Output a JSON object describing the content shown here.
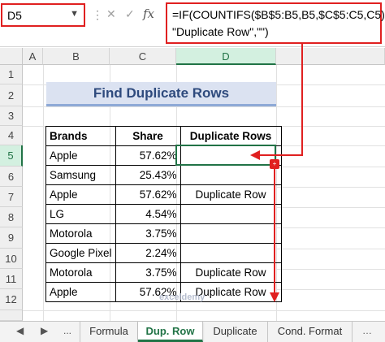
{
  "name_box": {
    "value": "D5"
  },
  "formula_bar": {
    "formula_line1": "=IF(COUNTIFS($B$5:B5,B5,$C$5:C5,C5)>1,",
    "formula_line2": "\"Duplicate Row\",\"\")",
    "fx_label": "fx"
  },
  "columns": [
    "A",
    "B",
    "C",
    "D"
  ],
  "rows": [
    "1",
    "2",
    "3",
    "4",
    "5",
    "6",
    "7",
    "8",
    "9",
    "10",
    "11",
    "12"
  ],
  "title": "Find Duplicate Rows",
  "table": {
    "headers": [
      "Brands",
      "Share",
      "Duplicate Rows"
    ],
    "rows": [
      [
        "Apple",
        "57.62%",
        ""
      ],
      [
        "Samsung",
        "25.43%",
        ""
      ],
      [
        "Apple",
        "57.62%",
        "Duplicate Row"
      ],
      [
        "LG",
        "4.54%",
        ""
      ],
      [
        "Motorola",
        "3.75%",
        ""
      ],
      [
        "Google Pixel",
        "2.24%",
        ""
      ],
      [
        "Motorola",
        "3.75%",
        "Duplicate Row"
      ],
      [
        "Apple",
        "57.62%",
        "Duplicate Row"
      ]
    ]
  },
  "sheet_tabs": {
    "nav": [
      "◀",
      "▶",
      "..."
    ],
    "tabs": [
      "Formula",
      "Dup. Row",
      "Duplicate",
      "Cond. Format"
    ],
    "active": "Dup. Row"
  },
  "watermark": "exceldemy",
  "colors": {
    "accent": "#217346",
    "annotation": "#e02020",
    "title_fill": "#dbe2f1",
    "title_text": "#2e4a7d"
  }
}
